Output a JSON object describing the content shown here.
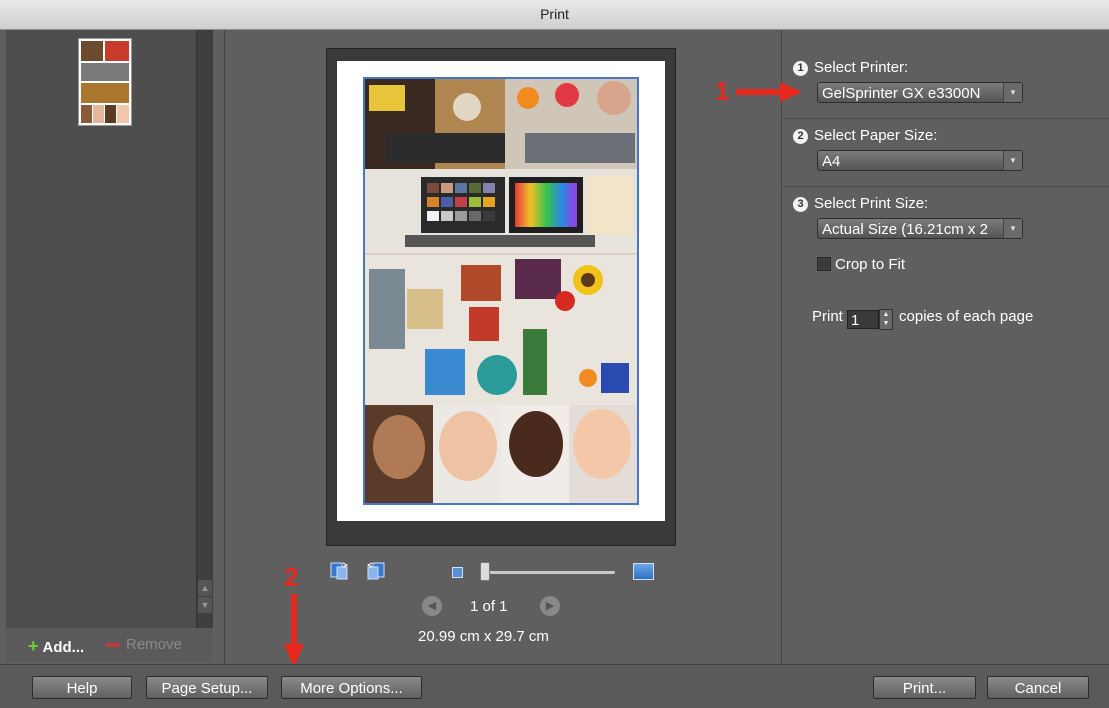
{
  "window": {
    "title": "Print"
  },
  "left_panel": {
    "add_label": "Add...",
    "remove_label": "Remove"
  },
  "preview": {
    "page_count": "1 of 1",
    "page_size": "20.99 cm x 29.7 cm",
    "zoom_level": 0.0
  },
  "settings": {
    "printer": {
      "step": "1",
      "label": "Select Printer:",
      "value": "GelSprinter GX e3300N"
    },
    "paper": {
      "step": "2",
      "label": "Select Paper Size:",
      "value": "A4"
    },
    "print_size": {
      "step": "3",
      "label": "Select Print Size:",
      "value": "Actual Size (16.21cm x 2"
    },
    "crop_to_fit": {
      "label": "Crop to Fit",
      "checked": false
    },
    "copies": {
      "prefix": "Print",
      "value": "1",
      "suffix": "copies of each page"
    }
  },
  "annotations": {
    "one": "1",
    "two": "2",
    "color": "#e8281f"
  },
  "buttons": {
    "help": "Help",
    "page_setup": "Page Setup...",
    "more_options": "More Options...",
    "print": "Print...",
    "cancel": "Cancel"
  }
}
